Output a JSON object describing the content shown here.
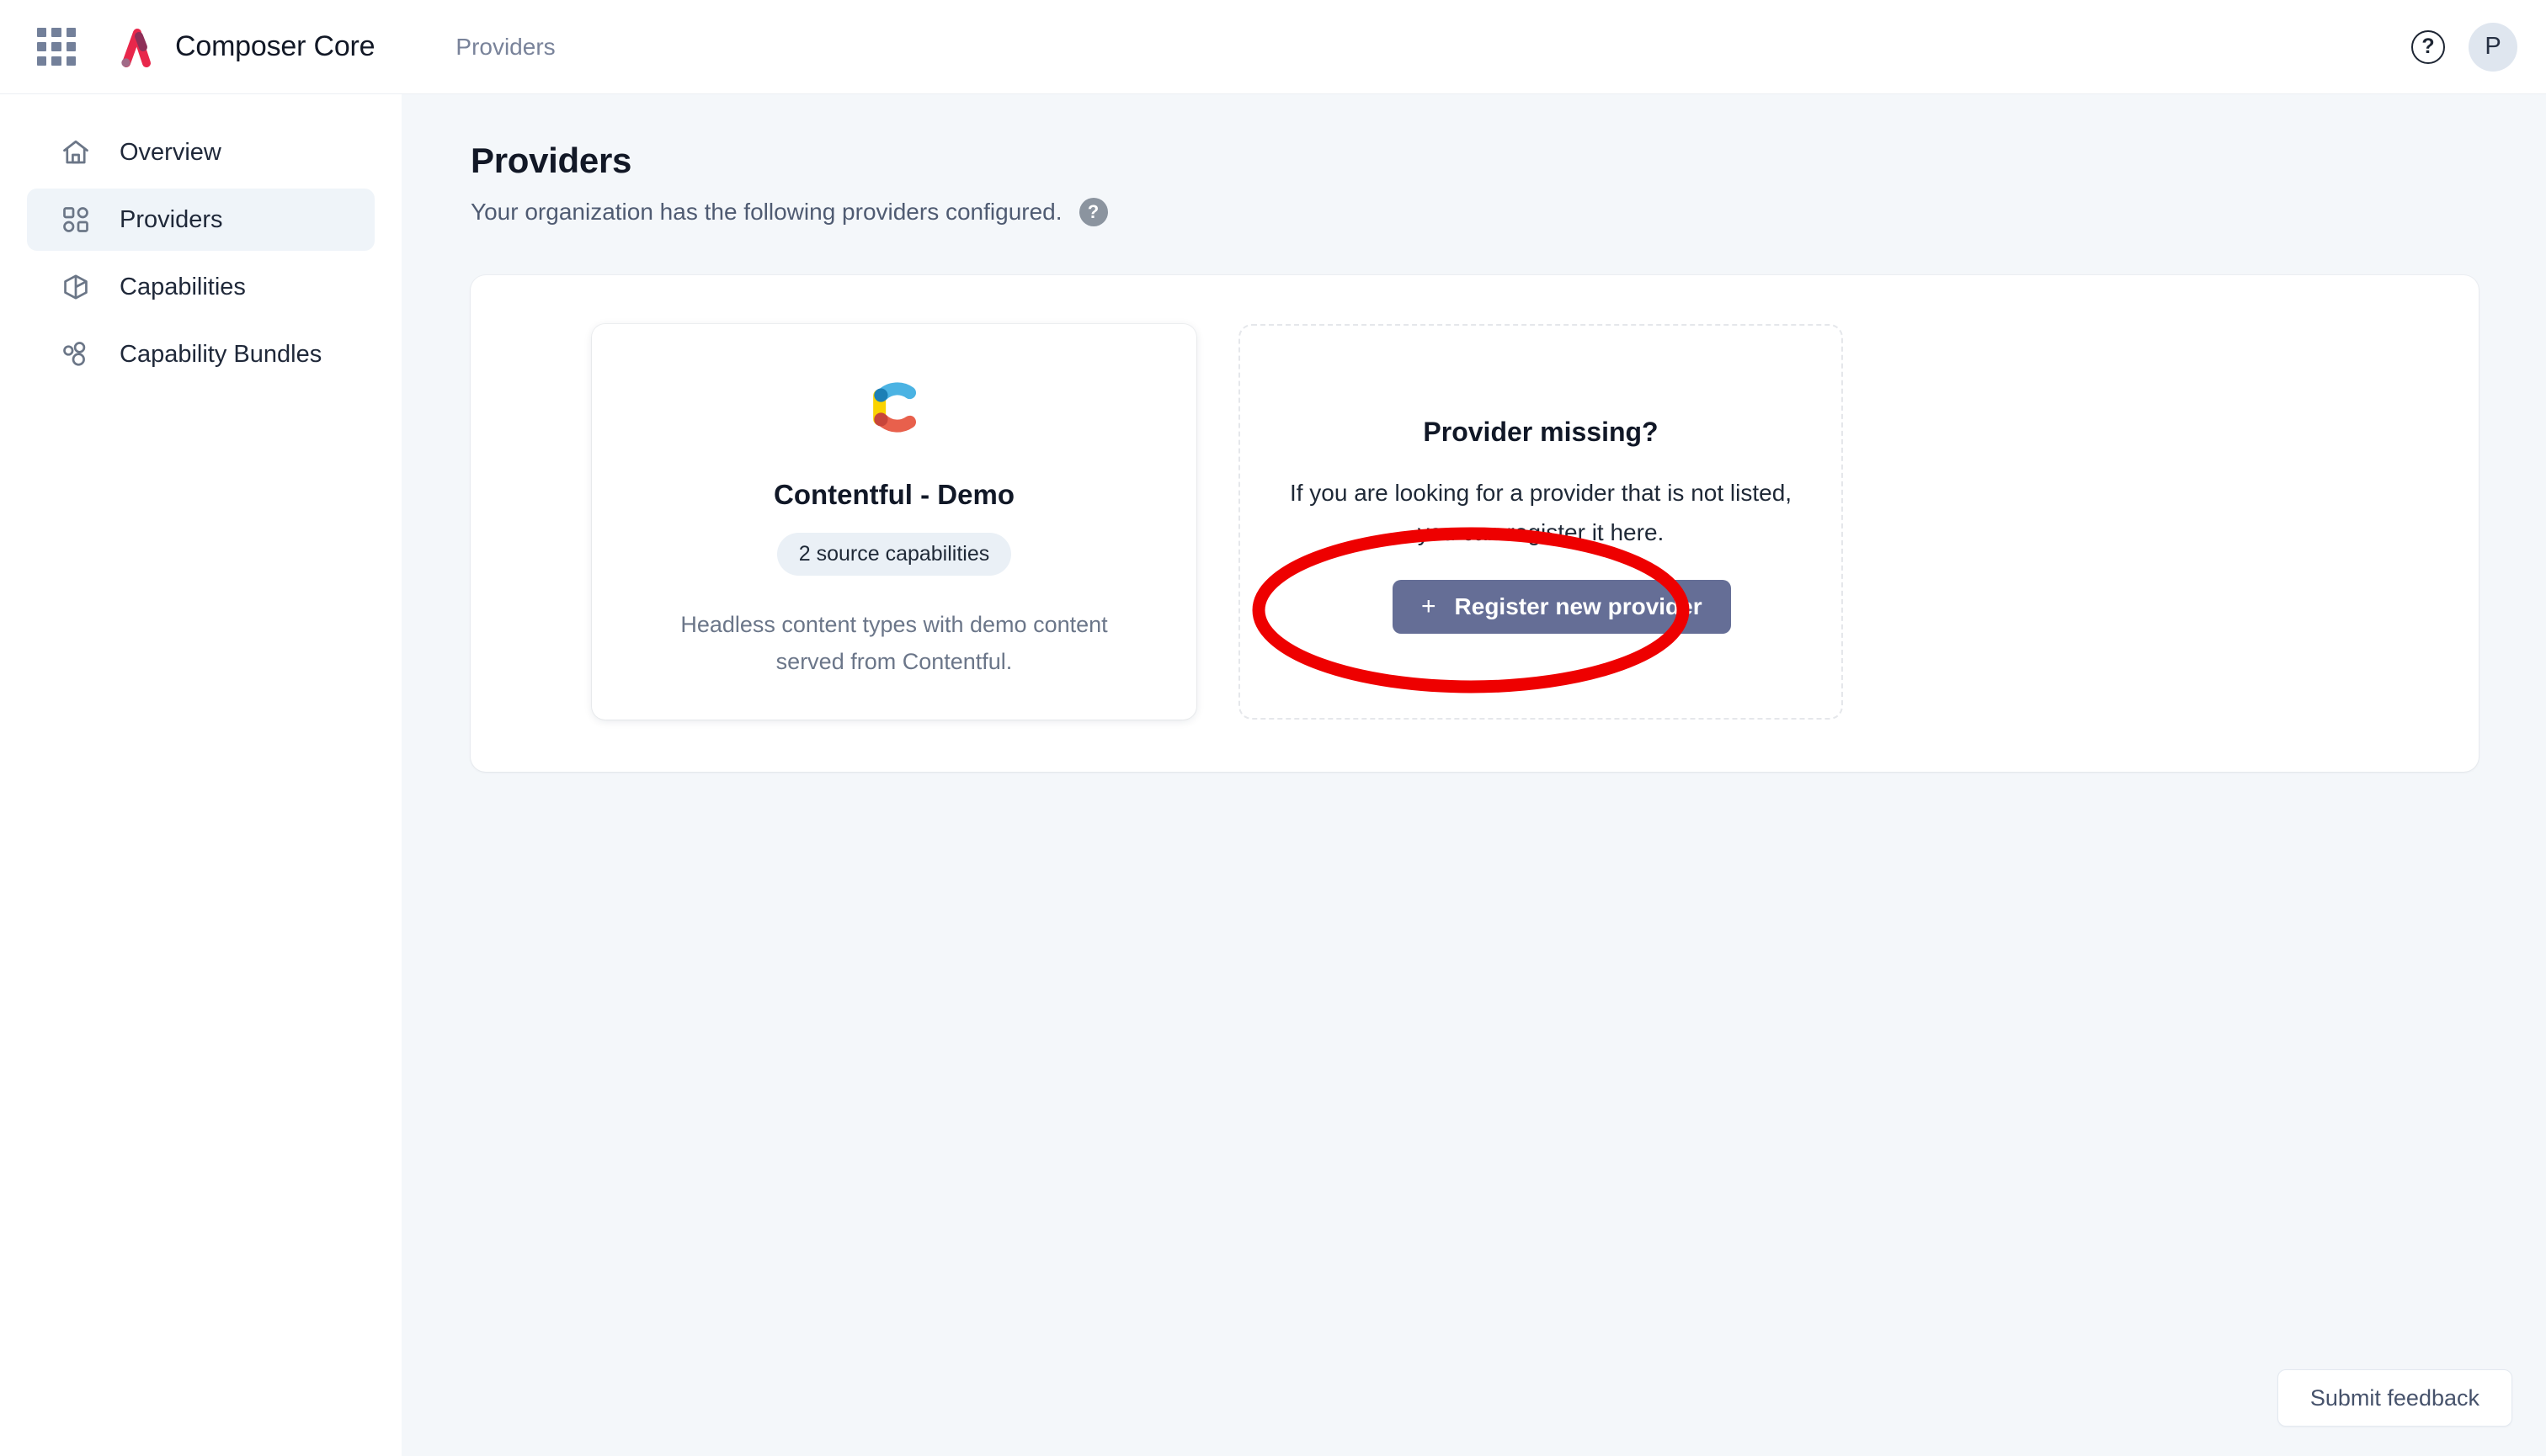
{
  "topbar": {
    "apps_icon": "apps-grid-icon",
    "brand_logo": "composer-logo-icon",
    "brand_name": "Composer Core",
    "breadcrumb": "Providers",
    "help_icon": "help-circle-icon",
    "help_glyph": "?",
    "avatar_initial": "P"
  },
  "sidebar": {
    "items": [
      {
        "label": "Overview",
        "icon": "home-icon",
        "active": false
      },
      {
        "label": "Providers",
        "icon": "dashboard-grid-icon",
        "active": true
      },
      {
        "label": "Capabilities",
        "icon": "cube-icon",
        "active": false
      },
      {
        "label": "Capability Bundles",
        "icon": "nodes-icon",
        "active": false
      }
    ]
  },
  "main": {
    "title": "Providers",
    "subtitle": "Your organization has the following providers configured.",
    "info_glyph": "?",
    "provider_card": {
      "logo": "contentful-logo-icon",
      "name": "Contentful - Demo",
      "badge": "2 source capabilities",
      "description": "Headless content types with demo content served from Contentful."
    },
    "missing_card": {
      "title": "Provider missing?",
      "text": "If you are looking for a provider that is not listed, you can register it here.",
      "button_plus": "+",
      "button_label": "Register new provider"
    }
  },
  "footer": {
    "feedback_label": "Submit feedback"
  },
  "annotation": {
    "shape": "red-ellipse-highlight",
    "color": "#ee0000",
    "target": "register-new-provider-button"
  },
  "colors": {
    "page_background": "#f4f7fa",
    "surface": "#ffffff",
    "accent_button": "#656e96",
    "sidebar_active": "#eff4f9",
    "badge_background": "#eaf0f6",
    "annotation_red": "#ee0000",
    "brand_red": "#e8274b",
    "brand_plum": "#8e2f58"
  }
}
